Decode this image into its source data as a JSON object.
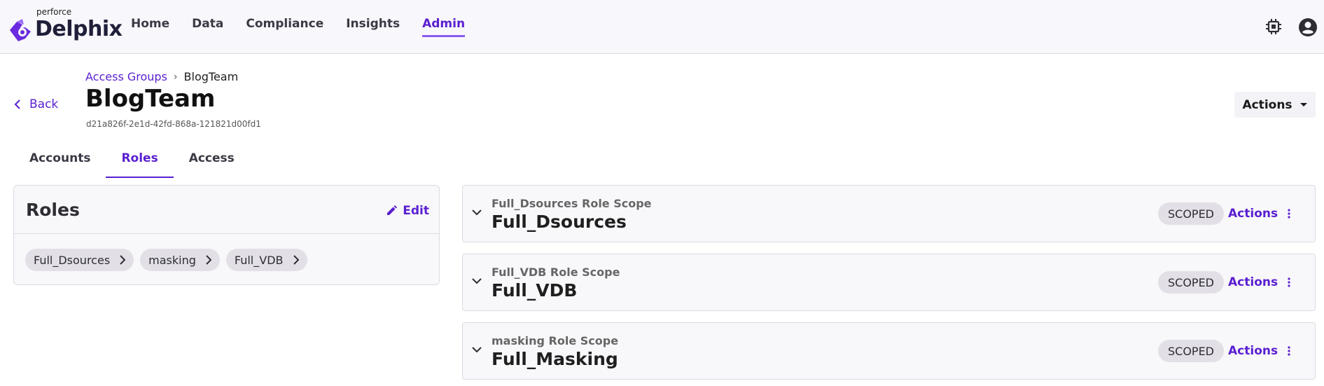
{
  "header": {
    "brand_small": "perforce",
    "brand_name": "Delphix",
    "nav": [
      {
        "label": "Home"
      },
      {
        "label": "Data"
      },
      {
        "label": "Compliance"
      },
      {
        "label": "Insights"
      },
      {
        "label": "Admin",
        "active": true
      }
    ],
    "icons": [
      "chip-icon",
      "account-circle-icon"
    ]
  },
  "breadcrumb": {
    "parent": "Access Groups",
    "current": "BlogTeam"
  },
  "back_label": "Back",
  "page": {
    "title": "BlogTeam",
    "id": "d21a826f-2e1d-42fd-868a-121821d00fd1",
    "actions_label": "Actions"
  },
  "tabs": [
    {
      "label": "Accounts"
    },
    {
      "label": "Roles",
      "active": true
    },
    {
      "label": "Access"
    }
  ],
  "roles_card": {
    "title": "Roles",
    "edit_label": "Edit",
    "chips": [
      "Full_Dsources",
      "masking",
      "Full_VDB"
    ]
  },
  "scopes": [
    {
      "subtitle": "Full_Dsources Role Scope",
      "name": "Full_Dsources",
      "badge": "SCOPED",
      "actions_label": "Actions"
    },
    {
      "subtitle": "Full_VDB Role Scope",
      "name": "Full_VDB",
      "badge": "SCOPED",
      "actions_label": "Actions"
    },
    {
      "subtitle": "masking Role Scope",
      "name": "Full_Masking",
      "badge": "SCOPED",
      "actions_label": "Actions"
    }
  ],
  "colors": {
    "accent": "#5a1fd0",
    "header_bg": "#f8f7fb",
    "chip_bg": "#e2e0e6"
  }
}
